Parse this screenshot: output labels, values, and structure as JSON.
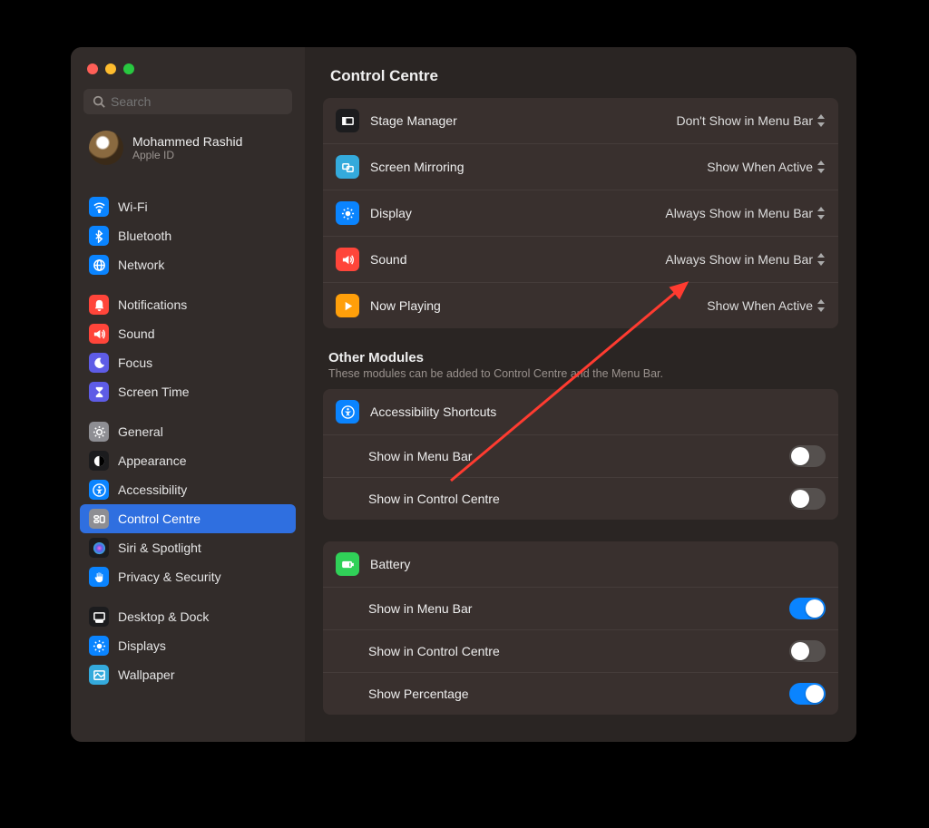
{
  "search": {
    "placeholder": "Search"
  },
  "user": {
    "name": "Mohammed Rashid",
    "sub": "Apple ID"
  },
  "sidebar": {
    "g1": [
      {
        "label": "Wi-Fi",
        "bg": "#0a84ff",
        "glyph": "wifi"
      },
      {
        "label": "Bluetooth",
        "bg": "#0a84ff",
        "glyph": "bt"
      },
      {
        "label": "Network",
        "bg": "#0a84ff",
        "glyph": "globe"
      }
    ],
    "g2": [
      {
        "label": "Notifications",
        "bg": "#ff453a",
        "glyph": "bell"
      },
      {
        "label": "Sound",
        "bg": "#ff453a",
        "glyph": "sound"
      },
      {
        "label": "Focus",
        "bg": "#5e5ce6",
        "glyph": "moon"
      },
      {
        "label": "Screen Time",
        "bg": "#5e5ce6",
        "glyph": "hourglass"
      }
    ],
    "g3": [
      {
        "label": "General",
        "bg": "#8e8e93",
        "glyph": "gear"
      },
      {
        "label": "Appearance",
        "bg": "#1c1c1e",
        "glyph": "appear"
      },
      {
        "label": "Accessibility",
        "bg": "#0a84ff",
        "glyph": "access"
      },
      {
        "label": "Control Centre",
        "bg": "#8e8e93",
        "glyph": "cc",
        "selected": true
      },
      {
        "label": "Siri & Spotlight",
        "bg": "#1c1c1e",
        "glyph": "siri"
      },
      {
        "label": "Privacy & Security",
        "bg": "#0a84ff",
        "glyph": "hand"
      }
    ],
    "g4": [
      {
        "label": "Desktop & Dock",
        "bg": "#1c1c1e",
        "glyph": "dock"
      },
      {
        "label": "Displays",
        "bg": "#0a84ff",
        "glyph": "display"
      },
      {
        "label": "Wallpaper",
        "bg": "#34aadc",
        "glyph": "wall"
      }
    ]
  },
  "header": {
    "title": "Control Centre"
  },
  "modules": [
    {
      "icon_bg": "#1c1c1e",
      "glyph": "stage",
      "label": "Stage Manager",
      "value": "Don't Show in Menu Bar"
    },
    {
      "icon_bg": "#34aadc",
      "glyph": "mirror",
      "label": "Screen Mirroring",
      "value": "Show When Active"
    },
    {
      "icon_bg": "#0a84ff",
      "glyph": "sun",
      "label": "Display",
      "value": "Always Show in Menu Bar"
    },
    {
      "icon_bg": "#ff453a",
      "glyph": "sound",
      "label": "Sound",
      "value": "Always Show in Menu Bar"
    },
    {
      "icon_bg": "#ff9f0a",
      "glyph": "play",
      "label": "Now Playing",
      "value": "Show When Active"
    }
  ],
  "other": {
    "title": "Other Modules",
    "sub": "These modules can be added to Control Centre and the Menu Bar.",
    "sections": [
      {
        "icon_bg": "#0a84ff",
        "glyph": "access",
        "label": "Accessibility Shortcuts",
        "rows": [
          {
            "label": "Show in Menu Bar",
            "on": false
          },
          {
            "label": "Show in Control Centre",
            "on": false
          }
        ]
      },
      {
        "icon_bg": "#30d158",
        "glyph": "battery",
        "label": "Battery",
        "rows": [
          {
            "label": "Show in Menu Bar",
            "on": true
          },
          {
            "label": "Show in Control Centre",
            "on": false
          },
          {
            "label": "Show Percentage",
            "on": true
          }
        ]
      }
    ]
  }
}
